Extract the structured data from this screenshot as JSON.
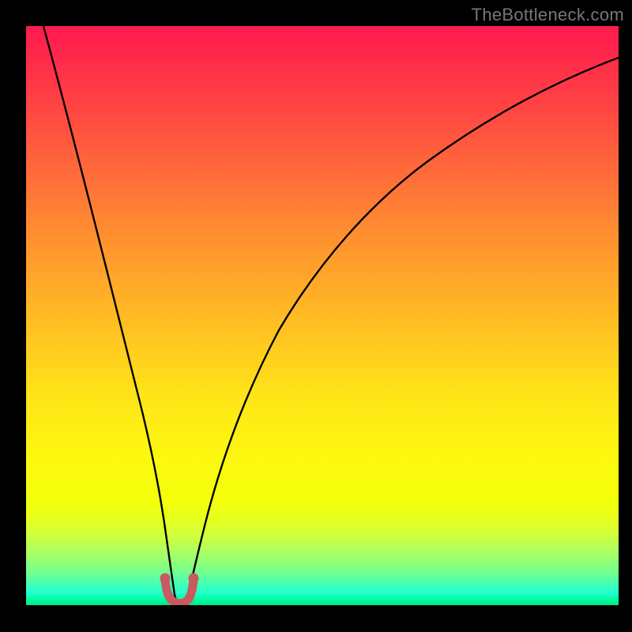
{
  "watermark": {
    "text": "TheBottleneck.com"
  },
  "chart_data": {
    "type": "line",
    "title": "",
    "xlabel": "",
    "ylabel": "",
    "xlim": [
      0,
      100
    ],
    "ylim": [
      0,
      100
    ],
    "grid": false,
    "series": [
      {
        "name": "bottleneck-curve",
        "x": [
          3,
          6,
          9,
          12,
          15,
          18,
          20,
          22,
          23,
          24,
          25,
          26,
          27,
          28,
          30,
          33,
          37,
          42,
          50,
          60,
          72,
          86,
          100
        ],
        "y": [
          100,
          86,
          72,
          58,
          44,
          30,
          19,
          9,
          4,
          1,
          0,
          0,
          1,
          4,
          10,
          19,
          30,
          41,
          53,
          63,
          72,
          79,
          84
        ]
      },
      {
        "name": "highlight-region",
        "x": [
          23,
          24,
          25,
          26,
          27
        ],
        "y": [
          3.5,
          0.8,
          0.3,
          0.8,
          3.5
        ]
      }
    ],
    "colors": {
      "curve": "#000000",
      "highlight": "#c95a5f",
      "gradient_top": "#ff1a4f",
      "gradient_bottom": "#00e689"
    }
  }
}
